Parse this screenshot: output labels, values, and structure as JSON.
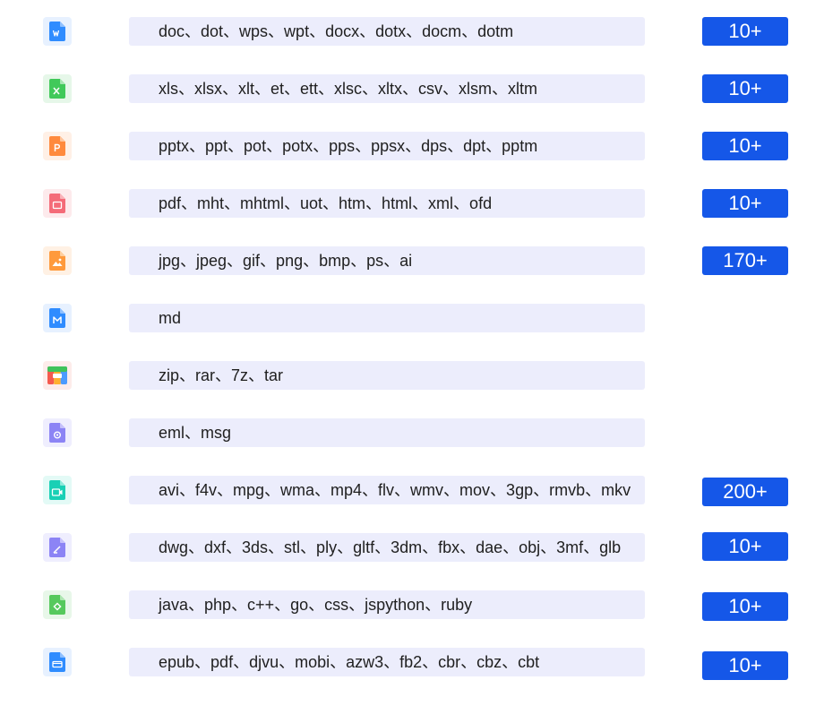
{
  "rows": [
    {
      "icon": "word-doc-icon",
      "color": "#2f8cff",
      "bg": "#e7f1ff",
      "formats": "doc、dot、wps、wpt、docx、dotx、docm、dotm",
      "count": "10+"
    },
    {
      "icon": "spreadsheet-icon",
      "color": "#41c95a",
      "bg": "#e6f7e9",
      "formats": "xls、xlsx、xlt、et、ett、xlsc、xltx、csv、xlsm、xltm",
      "count": "10+"
    },
    {
      "icon": "presentation-icon",
      "color": "#ff8a3d",
      "bg": "#fff0e6",
      "formats": "pptx、ppt、pot、potx、pps、ppsx、dps、dpt、pptm",
      "count": "10+"
    },
    {
      "icon": "pdf-icon",
      "color": "#f46b78",
      "bg": "#fdeaec",
      "formats": "pdf、mht、mhtml、uot、htm、html、xml、ofd",
      "count": "10+"
    },
    {
      "icon": "image-icon",
      "color": "#ff9a3c",
      "bg": "#fff1e4",
      "formats": "jpg、jpeg、gif、png、bmp、ps、ai",
      "count": "170+"
    },
    {
      "icon": "markdown-icon",
      "color": "#2f8cff",
      "bg": "#e7f1ff",
      "formats": "md",
      "count": ""
    },
    {
      "icon": "archive-icon",
      "color": "#f55a4e",
      "bg": "#fdecea",
      "formats": "zip、rar、7z、tar",
      "count": ""
    },
    {
      "icon": "email-icon",
      "color": "#8c84f5",
      "bg": "#efeefe",
      "formats": "eml、msg",
      "count": ""
    },
    {
      "icon": "video-icon",
      "color": "#19d0b5",
      "bg": "#e3faf6",
      "formats": "avi、f4v、mpg、wma、mp4、flv、wmv、mov、3gp、rmvb、mkv",
      "count": "200+"
    },
    {
      "icon": "cad-icon",
      "color": "#8c84f5",
      "bg": "#efeefe",
      "formats": "dwg、dxf、3ds、stl、ply、gltf、3dm、fbx、dae、obj、3mf、glb",
      "count": "10+"
    },
    {
      "icon": "code-icon",
      "color": "#56c95d",
      "bg": "#e8f7e9",
      "formats": "java、php、c++、go、css、jspython、ruby",
      "count": "10+"
    },
    {
      "icon": "ebook-icon",
      "color": "#2f8cff",
      "bg": "#e7f1ff",
      "formats": "epub、pdf、djvu、mobi、azw3、fb2、cbr、cbz、cbt",
      "count": "10+"
    }
  ]
}
